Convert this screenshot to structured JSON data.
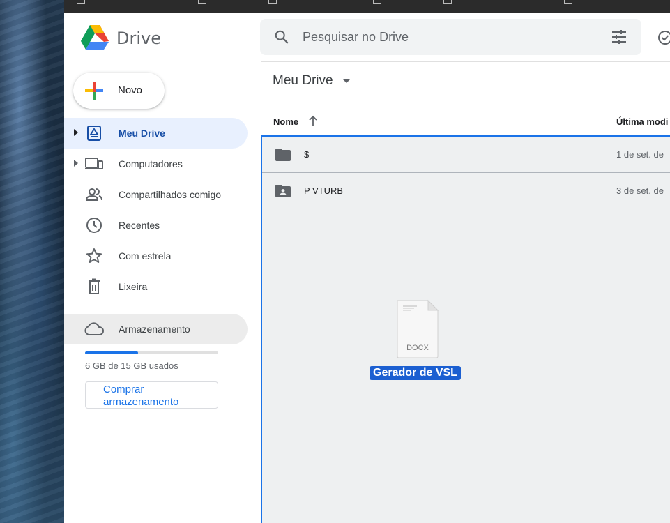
{
  "app": {
    "name": "Drive",
    "search_placeholder": "Pesquisar no Drive"
  },
  "sidebar": {
    "new_label": "Novo",
    "items": [
      {
        "label": "Meu Drive",
        "icon": "my-drive-icon",
        "active": true,
        "expandable": true
      },
      {
        "label": "Computadores",
        "icon": "computers-icon",
        "expandable": true
      },
      {
        "label": "Compartilhados comigo",
        "icon": "shared-people-icon"
      },
      {
        "label": "Recentes",
        "icon": "clock-icon"
      },
      {
        "label": "Com estrela",
        "icon": "star-icon"
      },
      {
        "label": "Lixeira",
        "icon": "trash-icon"
      }
    ],
    "storage": {
      "label": "Armazenamento",
      "used_fraction": 0.4,
      "usage_text": "6 GB de 15 GB usados",
      "buy_label": "Comprar armazenamento"
    }
  },
  "main": {
    "breadcrumb": "Meu Drive",
    "columns": {
      "name": "Nome",
      "modified": "Última modi"
    },
    "rows": [
      {
        "name": "$",
        "modified": "1 de set. de",
        "icon": "folder-icon"
      },
      {
        "name": "P VTURB",
        "modified": "3 de set. de",
        "icon": "shared-folder-icon"
      }
    ],
    "dragged_file": {
      "name": "Gerador de VSL",
      "type": "DOCX"
    }
  },
  "colors": {
    "accent": "#1a73e8",
    "active_nav_bg": "#e8f0fe",
    "active_nav_text": "#174ea6",
    "drop_zone_bg": "#eef0f1",
    "selection_label_bg": "#1b5fd1"
  }
}
